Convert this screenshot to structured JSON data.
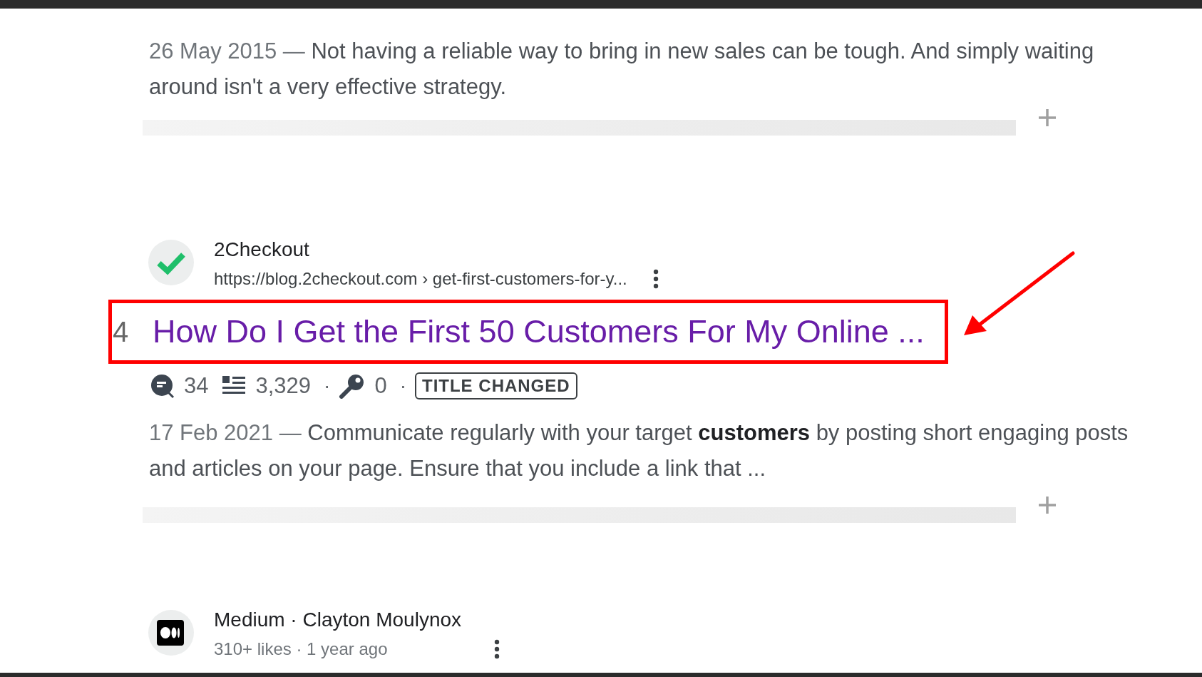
{
  "partial_result": {
    "snippet": {
      "date": "26 May 2015 —",
      "text": "Not having a reliable way to bring in new sales can be tough. And simply waiting around isn't a very effective strategy."
    }
  },
  "results": [
    {
      "kind": "check",
      "site": "2Checkout",
      "url": "https://blog.2checkout.com › get-first-customers-for-y...",
      "rank": "4",
      "title": "How Do I Get the First 50 Customers For My Online ...",
      "highlighted": true,
      "stats": [
        {
          "kind": "comments",
          "text": "34"
        },
        {
          "kind": "words",
          "text": "3,329"
        },
        {
          "kind": "separator",
          "text": "·"
        },
        {
          "kind": "keywords",
          "text": "0"
        },
        {
          "kind": "separator",
          "text": "·"
        },
        {
          "kind": "badge",
          "text": "TITLE CHANGED"
        }
      ],
      "snippet": {
        "date": "17 Feb 2021 —",
        "text": "Communicate regularly with your target **customers** by posting short engaging posts and articles on your page. Ensure that you include a link that ..."
      }
    },
    {
      "kind": "medium",
      "site": "Medium · Clayton Moulynox",
      "meta": "310+ likes · 1 year ago"
    }
  ]
}
